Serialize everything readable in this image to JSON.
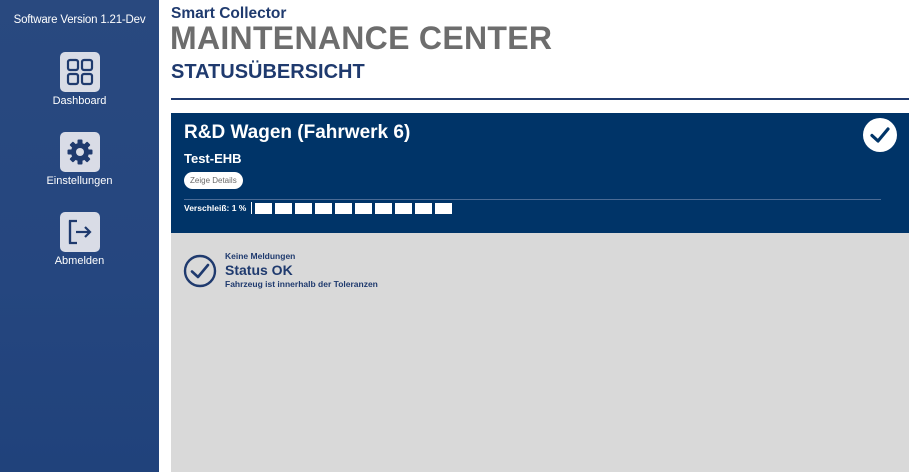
{
  "sidebar": {
    "version": "Software Version 1.21-Dev",
    "items": [
      {
        "label": "Dashboard",
        "icon": "grid-icon"
      },
      {
        "label": "Einstellungen",
        "icon": "gear-icon"
      },
      {
        "label": "Abmelden",
        "icon": "logout-icon"
      }
    ]
  },
  "header": {
    "app_name": "Smart Collector",
    "title": "MAINTENANCE CENTER",
    "section": "STATUSÜBERSICHT"
  },
  "card": {
    "title": "R&D Wagen (Fahrwerk 6)",
    "subtitle": "Test-EHB",
    "details_button": "Zeige Details",
    "wear_label": "Verschleiß: 1 %",
    "wear_percent": 1,
    "wear_segments": 10,
    "status_ok": true
  },
  "status": {
    "messages": "Keine Meldungen",
    "title": "Status OK",
    "description": "Fahrzeug ist innerhalb der Toleranzen"
  },
  "colors": {
    "sidebar": "#25467f",
    "card_header": "#003468",
    "card_body": "#d9d9d9",
    "brand_text": "#1f3a6e",
    "title_gray": "#6d6d6d"
  }
}
